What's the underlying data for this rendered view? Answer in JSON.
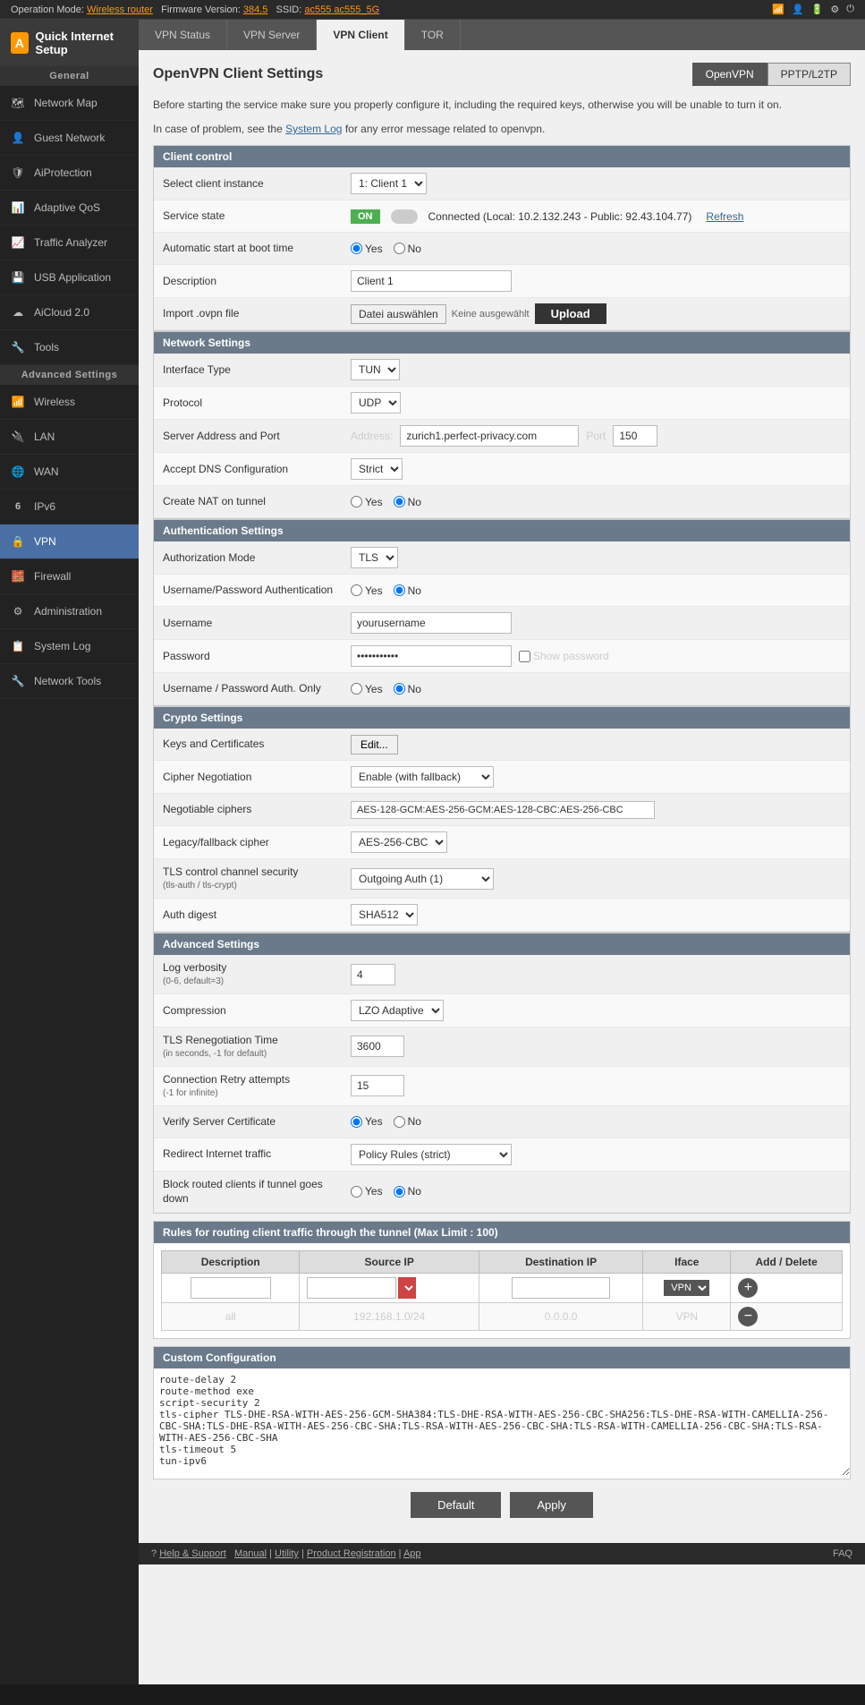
{
  "topbar": {
    "operation_mode_label": "Operation Mode:",
    "operation_mode_value": "Wireless router",
    "firmware_label": "Firmware Version:",
    "firmware_value": "384.5",
    "ssid_label": "SSID:",
    "ssid_value": "ac555  ac555_5G"
  },
  "sidebar": {
    "logo_text": "A",
    "header_title": "Quick Internet Setup",
    "general_label": "General",
    "items_general": [
      {
        "id": "network-map",
        "label": "Network Map",
        "icon": "🗺"
      },
      {
        "id": "guest-network",
        "label": "Guest Network",
        "icon": "👤"
      },
      {
        "id": "aiprotection",
        "label": "AiProtection",
        "icon": "🛡"
      },
      {
        "id": "adaptive-qos",
        "label": "Adaptive QoS",
        "icon": "📊"
      },
      {
        "id": "traffic-analyzer",
        "label": "Traffic Analyzer",
        "icon": "📈"
      },
      {
        "id": "usb-application",
        "label": "USB Application",
        "icon": "💾"
      },
      {
        "id": "aicloud",
        "label": "AiCloud 2.0",
        "icon": "☁"
      },
      {
        "id": "tools",
        "label": "Tools",
        "icon": "🔧"
      }
    ],
    "advanced_label": "Advanced Settings",
    "items_advanced": [
      {
        "id": "wireless",
        "label": "Wireless",
        "icon": "📶"
      },
      {
        "id": "lan",
        "label": "LAN",
        "icon": "🔌"
      },
      {
        "id": "wan",
        "label": "WAN",
        "icon": "🌐"
      },
      {
        "id": "ipv6",
        "label": "IPv6",
        "icon": "6"
      },
      {
        "id": "vpn",
        "label": "VPN",
        "icon": "🔒",
        "active": true
      },
      {
        "id": "firewall",
        "label": "Firewall",
        "icon": "🧱"
      },
      {
        "id": "administration",
        "label": "Administration",
        "icon": "⚙"
      },
      {
        "id": "system-log",
        "label": "System Log",
        "icon": "📋"
      },
      {
        "id": "network-tools",
        "label": "Network Tools",
        "icon": "🔧"
      }
    ]
  },
  "tabs": [
    {
      "id": "vpn-status",
      "label": "VPN Status"
    },
    {
      "id": "vpn-server",
      "label": "VPN Server"
    },
    {
      "id": "vpn-client",
      "label": "VPN Client",
      "active": true
    },
    {
      "id": "tor",
      "label": "TOR"
    }
  ],
  "page": {
    "title": "OpenVPN Client Settings",
    "mode_buttons": [
      {
        "id": "openvpn",
        "label": "OpenVPN",
        "active": true
      },
      {
        "id": "pptp",
        "label": "PPTP/L2TP"
      }
    ],
    "info_text1": "Before starting the service make sure you properly configure it, including the required keys, otherwise you will be unable to turn it on.",
    "info_text2": "In case of problem, see the",
    "system_log_link": "System Log",
    "info_text3": "for any error message related to openvpn."
  },
  "client_control": {
    "section_title": "Client control",
    "select_instance_label": "Select client instance",
    "select_instance_value": "1: Client 1",
    "service_state_label": "Service state",
    "service_state_on": "ON",
    "service_state_status": "Connected (Local: 10.2.132.243 - Public: 92.43.104.77)",
    "refresh_label": "Refresh",
    "auto_start_label": "Automatic start at boot time",
    "auto_start_yes": "Yes",
    "auto_start_no": "No",
    "description_label": "Description",
    "description_value": "Client 1",
    "import_label": "Import .ovpn file",
    "file_btn_label": "Datei auswählen",
    "no_file_label": "Keine ausgewählt",
    "upload_btn_label": "Upload"
  },
  "network_settings": {
    "section_title": "Network Settings",
    "interface_type_label": "Interface Type",
    "interface_type_value": "TUN",
    "protocol_label": "Protocol",
    "protocol_value": "UDP",
    "server_address_label": "Server Address and Port",
    "address_label": "Address:",
    "address_value": "zurich1.perfect-privacy.com",
    "port_label": "Port",
    "port_value": "150",
    "accept_dns_label": "Accept DNS Configuration",
    "accept_dns_value": "Strict",
    "create_nat_label": "Create NAT on tunnel",
    "create_nat_yes": "Yes",
    "create_nat_no": "No"
  },
  "auth_settings": {
    "section_title": "Authentication Settings",
    "auth_mode_label": "Authorization Mode",
    "auth_mode_value": "TLS",
    "user_pass_auth_label": "Username/Password Authentication",
    "user_pass_yes": "Yes",
    "user_pass_no": "No",
    "username_label": "Username",
    "username_value": "yourusername",
    "password_label": "Password",
    "password_value": "••••••••••••",
    "show_password_label": "Show password",
    "user_pass_only_label": "Username / Password Auth. Only",
    "user_pass_only_yes": "Yes",
    "user_pass_only_no": "No"
  },
  "crypto_settings": {
    "section_title": "Crypto Settings",
    "keys_label": "Keys and Certificates",
    "edit_btn_label": "Edit...",
    "cipher_neg_label": "Cipher Negotiation",
    "cipher_neg_value": "Enable (with fallback)",
    "negotiable_ciphers_label": "Negotiable ciphers",
    "negotiable_ciphers_value": "AES-128-GCM:AES-256-GCM:AES-128-CBC:AES-256-CBC",
    "legacy_cipher_label": "Legacy/fallback cipher",
    "legacy_cipher_value": "AES-256-CBC",
    "tls_control_label": "TLS control channel security\n(tls-auth / tls-crypt)",
    "tls_control_value": "Outgoing Auth (1)",
    "auth_digest_label": "Auth digest",
    "auth_digest_value": "SHA512"
  },
  "advanced_settings": {
    "section_title": "Advanced Settings",
    "log_verbosity_label": "Log verbosity\n(0-6, default=3)",
    "log_verbosity_value": "4",
    "compression_label": "Compression",
    "compression_value": "LZO Adaptive",
    "tls_renegotiation_label": "TLS Renegotiation Time\n(in seconds, -1 for default)",
    "tls_renegotiation_value": "3600",
    "connection_retry_label": "Connection Retry attempts\n(-1 for infinite)",
    "connection_retry_value": "15",
    "verify_server_label": "Verify Server Certificate",
    "verify_server_yes": "Yes",
    "verify_server_no": "No",
    "redirect_internet_label": "Redirect Internet traffic",
    "redirect_internet_value": "Policy Rules (strict)",
    "block_routed_label": "Block routed clients if tunnel goes down",
    "block_routed_yes": "Yes",
    "block_routed_no": "No"
  },
  "routing_table": {
    "section_title": "Rules for routing client traffic through the tunnel (Max Limit : 100)",
    "columns": [
      "Description",
      "Source IP",
      "Destination IP",
      "Iface",
      "Add / Delete"
    ],
    "rows": [
      {
        "description": "all",
        "source_ip": "192.168.1.0/24",
        "dest_ip": "0.0.0.0",
        "iface": "VPN"
      }
    ]
  },
  "custom_config": {
    "section_title": "Custom Configuration",
    "content": "route-delay 2\nroute-method exe\nscript-security 2\ntls-cipher TLS-DHE-RSA-WITH-AES-256-GCM-SHA384:TLS-DHE-RSA-WITH-AES-256-CBC-SHA256:TLS-DHE-RSA-WITH-CAMELLIA-256-CBC-SHA:TLS-DHE-RSA-WITH-AES-256-CBC-SHA:TLS-RSA-WITH-AES-256-CBC-SHA:TLS-RSA-WITH-CAMELLIA-256-CBC-SHA:TLS-RSA-WITH-AES-256-CBC-SHA\ntls-timeout 5\ntun-ipv6"
  },
  "bottom_buttons": {
    "default_label": "Default",
    "apply_label": "Apply"
  },
  "footer": {
    "help_icon": "?",
    "help_label": "Help & Support",
    "links": [
      "Manual",
      "Utility",
      "Product Registration",
      "App"
    ],
    "faq_label": "FAQ"
  }
}
